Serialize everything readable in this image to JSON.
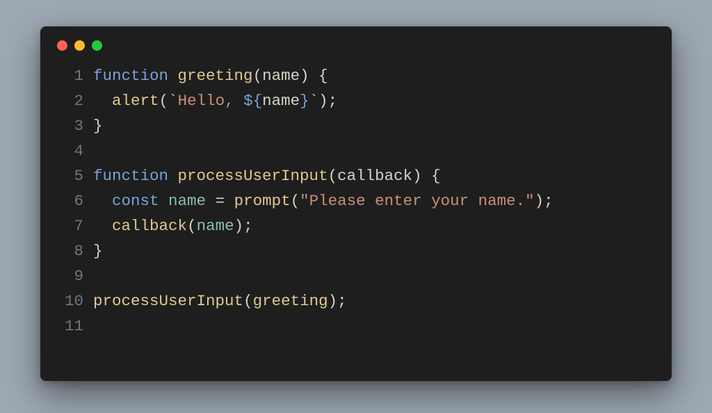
{
  "window": {
    "traffic_lights": [
      "close",
      "minimize",
      "zoom"
    ]
  },
  "code": {
    "language": "javascript",
    "plain_text": "function greeting(name) {\n  alert(`Hello, ${name}`);\n}\n\nfunction processUserInput(callback) {\n  const name = prompt(\"Please enter your name.\");\n  callback(name);\n}\n\nprocessUserInput(greeting);\n",
    "lines": [
      {
        "n": "1",
        "tokens": [
          {
            "t": "function ",
            "c": "kw"
          },
          {
            "t": "greeting",
            "c": "fn"
          },
          {
            "t": "(",
            "c": "pn"
          },
          {
            "t": "name",
            "c": "id"
          },
          {
            "t": ") {",
            "c": "pn"
          }
        ]
      },
      {
        "n": "2",
        "tokens": [
          {
            "t": "  ",
            "c": "id"
          },
          {
            "t": "alert",
            "c": "fn"
          },
          {
            "t": "(",
            "c": "pn"
          },
          {
            "t": "`",
            "c": "pn"
          },
          {
            "t": "Hello, ",
            "c": "str"
          },
          {
            "t": "${",
            "c": "tplp"
          },
          {
            "t": "name",
            "c": "id"
          },
          {
            "t": "}",
            "c": "tplp"
          },
          {
            "t": "`",
            "c": "pn"
          },
          {
            "t": ");",
            "c": "pn"
          }
        ]
      },
      {
        "n": "3",
        "tokens": [
          {
            "t": "}",
            "c": "pn"
          }
        ]
      },
      {
        "n": "4",
        "tokens": []
      },
      {
        "n": "5",
        "tokens": [
          {
            "t": "function ",
            "c": "kw"
          },
          {
            "t": "processUserInput",
            "c": "fn"
          },
          {
            "t": "(",
            "c": "pn"
          },
          {
            "t": "callback",
            "c": "id"
          },
          {
            "t": ") {",
            "c": "pn"
          }
        ]
      },
      {
        "n": "6",
        "tokens": [
          {
            "t": "  ",
            "c": "id"
          },
          {
            "t": "const ",
            "c": "kw"
          },
          {
            "t": "name",
            "c": "pr"
          },
          {
            "t": " = ",
            "c": "op"
          },
          {
            "t": "prompt",
            "c": "fn"
          },
          {
            "t": "(",
            "c": "pn"
          },
          {
            "t": "\"Please enter your name.\"",
            "c": "str"
          },
          {
            "t": ");",
            "c": "pn"
          }
        ]
      },
      {
        "n": "7",
        "tokens": [
          {
            "t": "  ",
            "c": "id"
          },
          {
            "t": "callback",
            "c": "fn"
          },
          {
            "t": "(",
            "c": "pn"
          },
          {
            "t": "name",
            "c": "pr"
          },
          {
            "t": ");",
            "c": "pn"
          }
        ]
      },
      {
        "n": "8",
        "tokens": [
          {
            "t": "}",
            "c": "pn"
          }
        ]
      },
      {
        "n": "9",
        "tokens": []
      },
      {
        "n": "10",
        "tokens": [
          {
            "t": "processUserInput",
            "c": "fn"
          },
          {
            "t": "(",
            "c": "pn"
          },
          {
            "t": "greeting",
            "c": "fn"
          },
          {
            "t": ");",
            "c": "pn"
          }
        ]
      },
      {
        "n": "11",
        "tokens": []
      }
    ]
  }
}
